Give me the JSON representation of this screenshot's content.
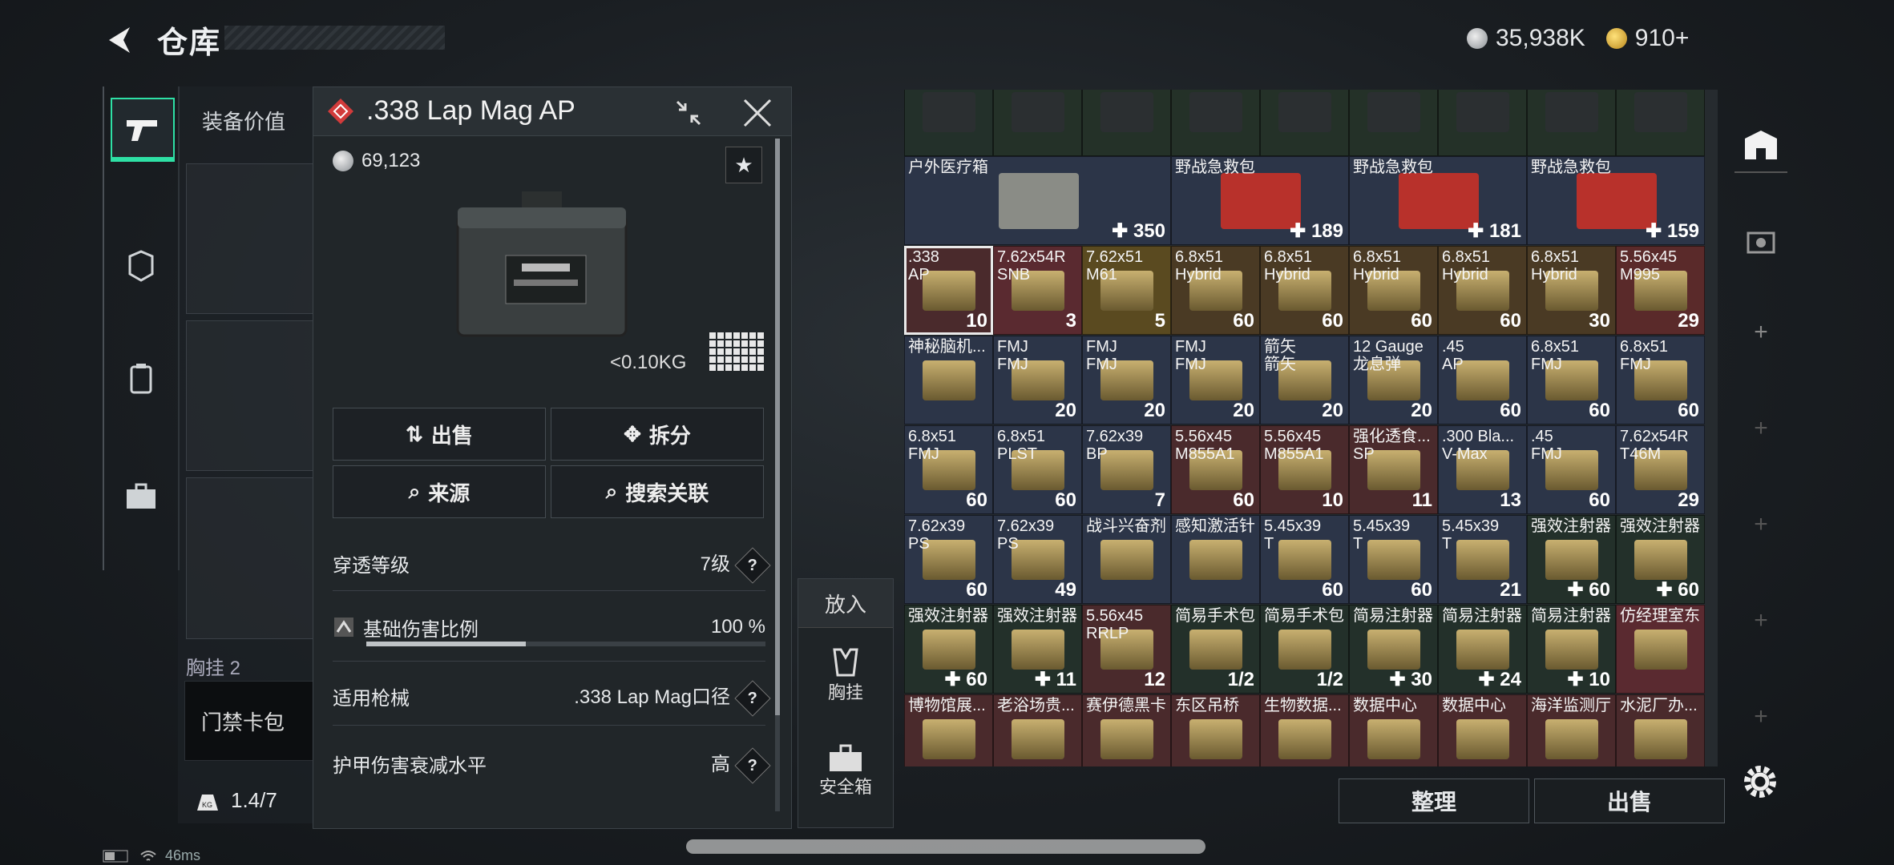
{
  "header": {
    "title": "仓库",
    "currency_silver": "35,938K",
    "currency_gold": "910+"
  },
  "equip_panel": {
    "label": "装备价值",
    "chest_label": "胸挂",
    "chest_count": "2",
    "keycard_button": "门禁卡包",
    "weight": "1.4/7"
  },
  "popup": {
    "title": ".338 Lap Mag AP",
    "price": "69,123",
    "weight": "<0.10KG",
    "buttons": {
      "sell": "出售",
      "split": "拆分",
      "source": "来源",
      "search_related": "搜索关联"
    },
    "props": [
      {
        "label": "穿透等级",
        "value": "7级"
      },
      {
        "label": "基础伤害比例",
        "value": "100 %",
        "bar": 0.4
      },
      {
        "label": "适用枪械",
        "value": ".338 Lap Mag口径"
      },
      {
        "label": "护甲伤害衰减水平",
        "value": "高"
      }
    ]
  },
  "putin": {
    "header": "放入",
    "chest": "胸挂",
    "safe": "安全箱"
  },
  "grid_rows": [
    [
      {
        "name": "",
        "count": "",
        "color": "#23302a",
        "img": "#2b2f31"
      },
      {
        "name": "",
        "count": "",
        "color": "#243128",
        "img": "#2b2f31"
      },
      {
        "name": "",
        "count": "",
        "color": "#243128",
        "img": "#2b2f31"
      },
      {
        "name": "",
        "count": "",
        "color": "#243128",
        "img": "#2b2f31"
      },
      {
        "name": "",
        "count": "",
        "color": "#243128",
        "img": "#2b2f31"
      },
      {
        "name": "",
        "count": "",
        "color": "#243128",
        "img": "#2b2f31"
      },
      {
        "name": "",
        "count": "",
        "color": "#243128",
        "img": "#2b2f31"
      },
      {
        "name": "",
        "count": "",
        "color": "#243128",
        "img": "#2b2f31"
      },
      {
        "name": "",
        "count": "",
        "color": "#243128",
        "img": "#2b2f31"
      }
    ]
  ],
  "grid": {
    "medkits": [
      {
        "name": "户外医疗箱",
        "count": "✚ 350"
      },
      {
        "name": "野战急救包",
        "count": "✚ 189"
      },
      {
        "name": "野战急救包",
        "count": "✚ 181"
      },
      {
        "name": "野战急救包",
        "count": "✚ 159"
      }
    ],
    "row3": [
      {
        "name": ".338\nAP",
        "count": "10",
        "color": "#4a2a2c"
      },
      {
        "name": "7.62x54R\nSNB",
        "count": "3",
        "color": "#5a2a30"
      },
      {
        "name": "7.62x51\nM61",
        "count": "5",
        "color": "#5a4a20"
      },
      {
        "name": "6.8x51\nHybrid",
        "count": "60",
        "color": "#4a3a24"
      },
      {
        "name": "6.8x51\nHybrid",
        "count": "60",
        "color": "#4a3a24"
      },
      {
        "name": "6.8x51\nHybrid",
        "count": "60",
        "color": "#4a3a24"
      },
      {
        "name": "6.8x51\nHybrid",
        "count": "60",
        "color": "#4a3a24"
      },
      {
        "name": "6.8x51\nHybrid",
        "count": "30",
        "color": "#4a3a24"
      },
      {
        "name": "5.56x45\nM995",
        "count": "29",
        "color": "#5a2a2a"
      }
    ],
    "row4": [
      {
        "name": "神秘脑机...",
        "count": "",
        "color": "#2c3548"
      },
      {
        "name": "FMJ\nFMJ",
        "count": "20",
        "color": "#2c3548"
      },
      {
        "name": "FMJ\nFMJ",
        "count": "20",
        "color": "#2c3548"
      },
      {
        "name": "FMJ\nFMJ",
        "count": "20",
        "color": "#2c3548"
      },
      {
        "name": "箭矢\n箭矢",
        "count": "20",
        "color": "#2c3548"
      },
      {
        "name": "12 Gauge\n龙息弹",
        "count": "20",
        "color": "#2c3548"
      },
      {
        "name": ".45\nAP",
        "count": "60",
        "color": "#2c3548"
      },
      {
        "name": "6.8x51\nFMJ",
        "count": "60",
        "color": "#2c3548"
      },
      {
        "name": "6.8x51\nFMJ",
        "count": "60",
        "color": "#2c3548"
      }
    ],
    "row5": [
      {
        "name": "6.8x51\nFMJ",
        "count": "60",
        "color": "#2c3548"
      },
      {
        "name": "6.8x51\nPLST",
        "count": "60",
        "color": "#2c3548"
      },
      {
        "name": "7.62x39\nBP",
        "count": "7",
        "color": "#2c3548"
      },
      {
        "name": "5.56x45\nM855A1",
        "count": "60",
        "color": "#4a2a2c"
      },
      {
        "name": "5.56x45\nM855A1",
        "count": "10",
        "color": "#4a2a2c"
      },
      {
        "name": "强化透食...\nSP",
        "count": "11",
        "color": "#4a2a2c"
      },
      {
        "name": ".300 Bla...\nV-Max",
        "count": "13",
        "color": "#2c3548"
      },
      {
        "name": ".45\nFMJ",
        "count": "60",
        "color": "#2c3548"
      },
      {
        "name": "7.62x54R\nT46M",
        "count": "29",
        "color": "#2c3548"
      }
    ],
    "row6": [
      {
        "name": "7.62x39\nPS",
        "count": "60",
        "color": "#2c3548"
      },
      {
        "name": "7.62x39\nPS",
        "count": "49",
        "color": "#2c3548"
      },
      {
        "name": "战斗兴奋剂",
        "count": "",
        "color": "#2c3548"
      },
      {
        "name": "感知激活针",
        "count": "",
        "color": "#2c3548"
      },
      {
        "name": "5.45x39\nT",
        "count": "60",
        "color": "#2c3548"
      },
      {
        "name": "5.45x39\nT",
        "count": "60",
        "color": "#2c3548"
      },
      {
        "name": "5.45x39\nT",
        "count": "21",
        "color": "#2c3548"
      },
      {
        "name": "强效注射器",
        "count": "✚ 60",
        "color": "#23302a"
      },
      {
        "name": "强效注射器",
        "count": "✚ 60",
        "color": "#23302a"
      }
    ],
    "row7": [
      {
        "name": "强效注射器",
        "count": "✚ 60",
        "color": "#23302a"
      },
      {
        "name": "强效注射器",
        "count": "✚ 11",
        "color": "#23302a"
      },
      {
        "name": "5.56x45\nRRLP",
        "count": "12",
        "color": "#4a2a2c"
      },
      {
        "name": "简易手术包",
        "count": "1/2",
        "color": "#23302a"
      },
      {
        "name": "简易手术包",
        "count": "1/2",
        "color": "#23302a"
      },
      {
        "name": "简易注射器",
        "count": "✚ 30",
        "color": "#23302a"
      },
      {
        "name": "简易注射器",
        "count": "✚ 24",
        "color": "#23302a"
      },
      {
        "name": "简易注射器",
        "count": "✚ 10",
        "color": "#23302a"
      },
      {
        "name": "仿经理室东",
        "count": "",
        "color": "#5a2a30"
      }
    ],
    "row8": [
      {
        "name": "博物馆展...",
        "count": "",
        "color": "#4a2a2c"
      },
      {
        "name": "老浴场贵...",
        "count": "",
        "color": "#4a2a2c"
      },
      {
        "name": "赛伊德黑卡",
        "count": "",
        "color": "#4a2a2c"
      },
      {
        "name": "东区吊桥",
        "count": "",
        "color": "#4a2a2c"
      },
      {
        "name": "生物数据...",
        "count": "",
        "color": "#4a2a2c"
      },
      {
        "name": "数据中心",
        "count": "",
        "color": "#4a2a2c"
      },
      {
        "name": "数据中心",
        "count": "",
        "color": "#4a2a2c"
      },
      {
        "name": "海洋监测厅",
        "count": "",
        "color": "#4a2a2c"
      },
      {
        "name": "水泥厂办...",
        "count": "",
        "color": "#4a2a2c"
      }
    ]
  },
  "bottom": {
    "sort": "整理",
    "sell": "出售"
  },
  "status": {
    "ping": "46ms"
  }
}
